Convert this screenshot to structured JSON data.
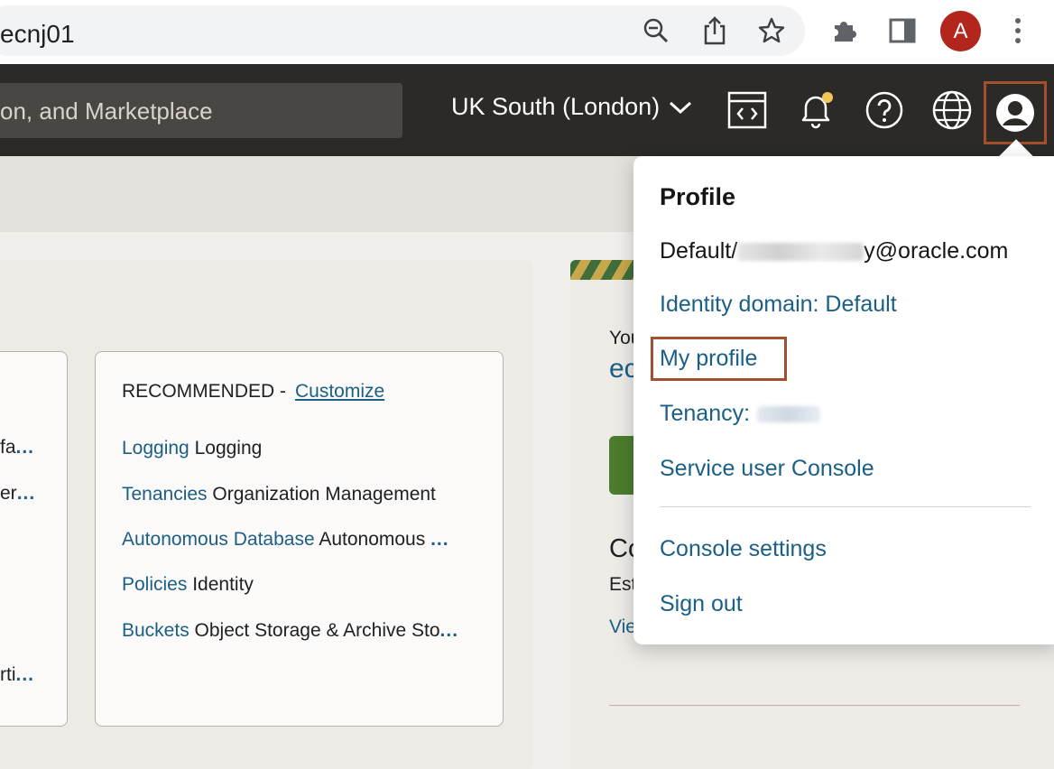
{
  "browser": {
    "url_fragment": "ecnj01",
    "avatar_letter": "A"
  },
  "header": {
    "search_placeholder": "on, and Marketplace",
    "region": "UK South (London)"
  },
  "left_card": {
    "lines": [
      "fa",
      "er",
      "rti"
    ]
  },
  "recommended": {
    "title": "RECOMMENDED -",
    "customize": "Customize",
    "items": [
      {
        "link": "Logging",
        "desc": "Logging"
      },
      {
        "link": "Tenancies",
        "desc": "Organization Management"
      },
      {
        "link": "Autonomous Database",
        "desc": "Autonomous"
      },
      {
        "link": "Policies",
        "desc": "Identity"
      },
      {
        "link": "Buckets",
        "desc": "Object Storage & Archive Sto"
      }
    ],
    "ellipsis": "..."
  },
  "right_panel": {
    "you": "You",
    "ec": "ec",
    "co": "Co",
    "est": "Est",
    "view": "Vie"
  },
  "profile_menu": {
    "title": "Profile",
    "user_prefix": "Default/",
    "user_suffix": "y@oracle.com",
    "identity_domain": "Identity domain: Default",
    "my_profile": "My profile",
    "tenancy": "Tenancy:",
    "service_user_console": "Service user Console",
    "console_settings": "Console settings",
    "sign_out": "Sign out"
  },
  "colors": {
    "link": "#1a5f85",
    "highlight": "#a2502f",
    "header_bg": "#2c2a27",
    "notification_dot": "#f0c85a"
  }
}
